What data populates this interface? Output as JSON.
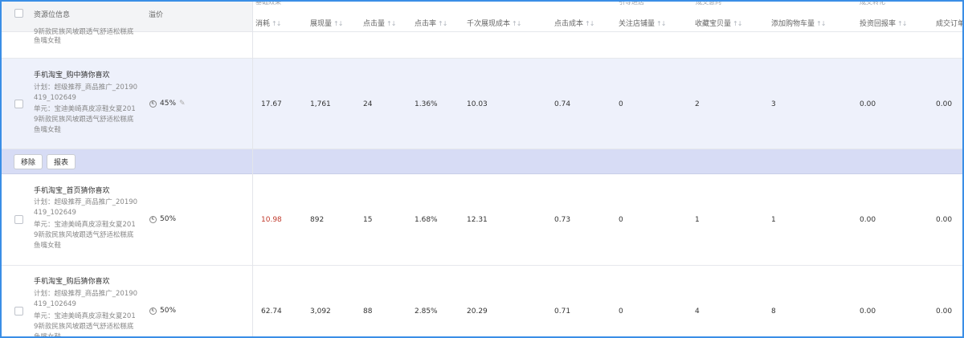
{
  "header": {
    "resource_info": "资源位信息",
    "premium": "溢价",
    "groups": [
      "基础效果",
      "引导进店",
      "成交意向",
      "成交转化"
    ],
    "columns": [
      "消耗",
      "展现量",
      "点击量",
      "点击率",
      "千次展现成本",
      "点击成本",
      "关注店铺量",
      "收藏宝贝量",
      "添加购物车量",
      "投资回报率",
      "成交订单"
    ],
    "sort_glyph": "↑↓"
  },
  "top_partial": {
    "line1": "9新款民族风坡跟透气舒适松糕底",
    "line2": "鱼嘴女鞋"
  },
  "rows": [
    {
      "title": "手机淘宝_购中猜你喜欢",
      "plan": "计划：超级推荐_商品推广_20190419_102649",
      "unit": "单元：宝迪美崎真皮凉鞋女夏2019新款民族风坡跟透气舒适松糕底鱼嘴女鞋",
      "premium": "45%",
      "values": [
        "17.67",
        "1,761",
        "24",
        "1.36%",
        "10.03",
        "0.74",
        "0",
        "2",
        "3",
        "0.00",
        "0.00"
      ]
    },
    {
      "title": "手机淘宝_首页猜你喜欢",
      "plan": "计划：超级推荐_商品推广_20190419_102649",
      "unit": "单元：宝迪美崎真皮凉鞋女夏2019新款民族风坡跟透气舒适松糕底鱼嘴女鞋",
      "premium": "50%",
      "values": [
        "10.98",
        "892",
        "15",
        "1.68%",
        "12.31",
        "0.73",
        "0",
        "1",
        "1",
        "0.00",
        "0.00"
      ]
    },
    {
      "title": "手机淘宝_购后猜你喜欢",
      "plan": "计划：超级推荐_商品推广_20190419_102649",
      "unit": "单元：宝迪美崎真皮凉鞋女夏2019新款民族风坡跟透气舒适松糕底鱼嘴女鞋",
      "premium": "50%",
      "values": [
        "62.74",
        "3,092",
        "88",
        "2.85%",
        "20.29",
        "0.71",
        "0",
        "4",
        "8",
        "0.00",
        "0.00"
      ]
    }
  ],
  "actions": {
    "remove": "移除",
    "report": "报表"
  },
  "icons": {
    "premium_icon": "coin-icon",
    "edit_icon": "pencil-icon"
  },
  "colors": {
    "frame_border": "#3a8ee6",
    "selected_row_bg": "#eef1fb",
    "action_bar_bg": "#d7dcf5",
    "cost_highlight": "#c0392b"
  }
}
